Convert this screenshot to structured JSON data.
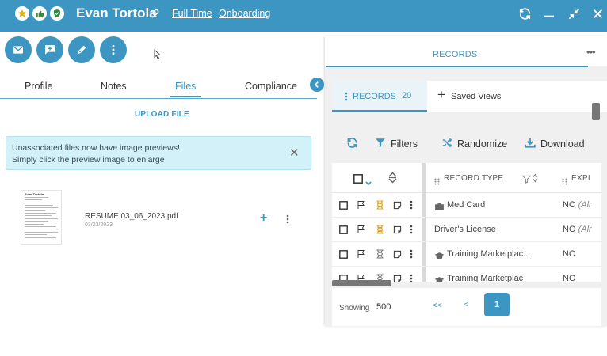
{
  "header": {
    "name": "Evan Tortola",
    "links": [
      "Full Time",
      "Onboarding"
    ],
    "badges": [
      "star-icon",
      "thumbs-up-icon",
      "shield-check-icon"
    ],
    "controls": [
      "refresh-icon",
      "minimize-icon",
      "collapse-icon",
      "close-icon"
    ]
  },
  "actions": [
    "email-icon",
    "message-icon",
    "edit-pen-icon",
    "more-vertical-icon"
  ],
  "tabs": [
    {
      "label": "Profile",
      "active": false
    },
    {
      "label": "Notes",
      "active": false
    },
    {
      "label": "Files",
      "active": true
    },
    {
      "label": "Compliance",
      "active": false
    }
  ],
  "files": {
    "upload_label": "UPLOAD FILE",
    "info_lines": [
      "Unassociated files now have image previews!",
      "Simply click the preview image to enlarge"
    ],
    "items": [
      {
        "name": "RESUME 03_06_2023.pdf",
        "date": "03/23/2023",
        "thumb_title": "Evan Tortola"
      }
    ]
  },
  "records_panel": {
    "title": "RECORDS",
    "tab_label": "RECORDS",
    "tab_count": "20",
    "saved_views_label": "Saved Views",
    "toolbar": {
      "filters": "Filters",
      "randomize": "Randomize",
      "download": "Download"
    },
    "columns": {
      "record_type": "RECORD TYPE",
      "expiration": "EXPI"
    },
    "rows": [
      {
        "type": "Med Card",
        "icon": "medical-card-icon",
        "exp": "NO",
        "exp_note": "(Alr",
        "status_color": "#e3a21a"
      },
      {
        "type": "Driver's License",
        "icon": "",
        "exp": "NO",
        "exp_note": "(Alr",
        "status_color": "#e3a21a"
      },
      {
        "type": "Training Marketplac...",
        "icon": "graduation-cap-icon",
        "exp": "NO",
        "exp_note": "",
        "status_color": "#777777"
      },
      {
        "type": "Training Marketplac",
        "icon": "graduation-cap-icon",
        "exp": "NO",
        "exp_note": "",
        "status_color": "#777777"
      }
    ],
    "pager": {
      "showing_label": "Showing",
      "page_size": "500",
      "first": "<<",
      "prev": "<",
      "current": "1"
    }
  },
  "colors": {
    "brand": "#3d96c2",
    "info_bg": "#d2f1f8",
    "pending": "#e3a21a"
  }
}
